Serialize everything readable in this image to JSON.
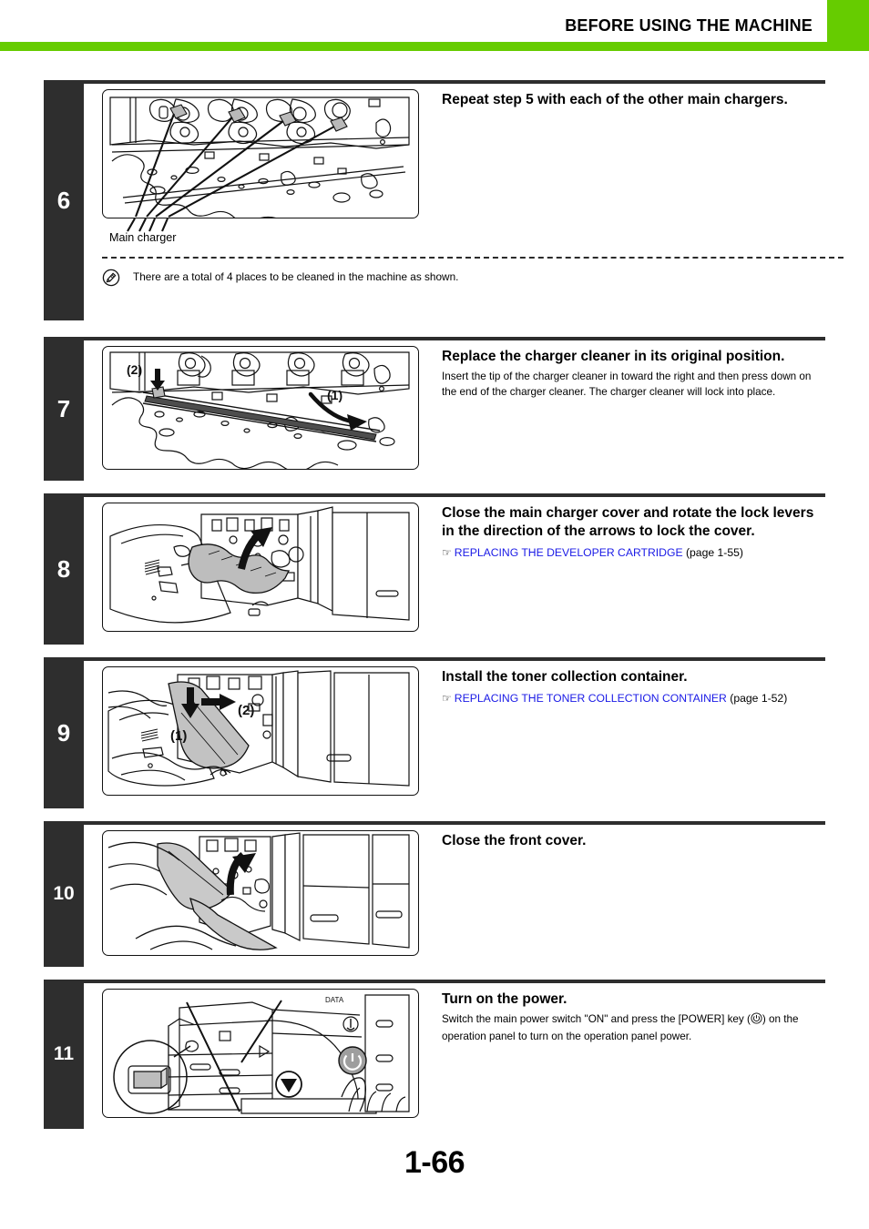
{
  "header": {
    "title": "BEFORE USING THE MACHINE",
    "accent_color": "#66cc00"
  },
  "page": {
    "number": "1-66",
    "number_color": "#000000",
    "link_color": "#1a1ae6",
    "step_block_color": "#2e2e2e"
  },
  "steps": [
    {
      "number": "6",
      "title": "Repeat step 5 with each of the other main chargers.",
      "illustration_caption": "Main charger",
      "illustration_name": "main-charger-locations-illustration",
      "note": {
        "icon": "pencil-note-icon",
        "text": "There are a total of 4 places to be cleaned in the machine as shown."
      }
    },
    {
      "number": "7",
      "title": "Replace the charger cleaner in its original position.",
      "description": "Insert the tip of the charger cleaner in toward the right and then press down on the end of the charger cleaner. The charger cleaner will lock into place.",
      "illustration_name": "charger-cleaner-replacement-illustration",
      "callouts": [
        "(2)",
        "(1)"
      ]
    },
    {
      "number": "8",
      "title": "Close the main charger cover and rotate the lock levers in the direction of the arrows to lock the cover.",
      "reference": {
        "icon": "pointing-hand-icon",
        "link_text": "REPLACING THE DEVELOPER CARTRIDGE",
        "page_text": "(page 1-55)"
      },
      "illustration_name": "close-main-charger-cover-illustration"
    },
    {
      "number": "9",
      "title": "Install the toner collection container.",
      "reference": {
        "icon": "pointing-hand-icon",
        "link_text": "REPLACING THE TONER COLLECTION CONTAINER",
        "page_text": "(page 1-52)"
      },
      "illustration_name": "install-toner-collection-container-illustration",
      "callouts": [
        "(1)",
        "(2)"
      ]
    },
    {
      "number": "10",
      "title": "Close the front cover.",
      "illustration_name": "close-front-cover-illustration"
    },
    {
      "number": "11",
      "title": "Turn on the power.",
      "description_part1": "Switch the main power switch \"ON\" and press the [POWER] key (",
      "description_power_symbol": "power-key-icon",
      "description_part2": ") on the operation panel to turn on the operation panel power.",
      "illustration_name": "turn-on-power-illustration"
    }
  ]
}
